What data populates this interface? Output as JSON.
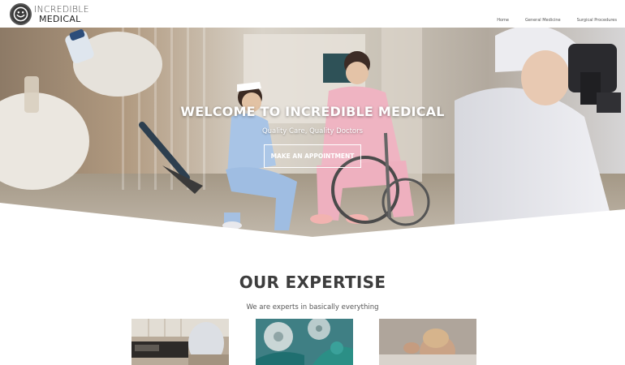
{
  "header": {
    "logo_line1": "INCREDIBLE",
    "logo_line2": "MEDICAL",
    "logo_icon": "smiley-face-icon",
    "nav": [
      "Home",
      "General Medicine",
      "Surgical Procedures"
    ]
  },
  "hero": {
    "title": "WELCOME TO INCREDIBLE MEDICAL",
    "subtitle": "Quality Care, Quality Doctors",
    "cta_label": "MAKE AN APPOINTMENT"
  },
  "expertise": {
    "title": "OUR EXPERTISE",
    "subtitle": "We are experts in basically everything",
    "cards": [
      "clinic-photo",
      "surgery-photo",
      "child-patient-photo"
    ]
  },
  "colors": {
    "header_bg": "#ffffff",
    "logo_circle": "#3a3a3a",
    "heading": "#3d3d3d",
    "hero_text": "#ffffff"
  }
}
